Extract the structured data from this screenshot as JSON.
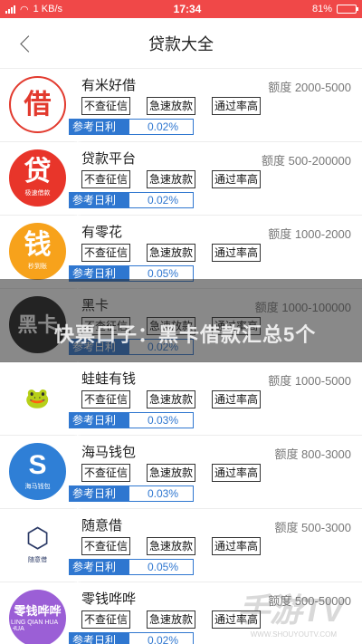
{
  "status_bar": {
    "network": "1 KB/s",
    "time": "17:34",
    "battery": "81%",
    "battery_level": 0.81
  },
  "nav": {
    "title": "贷款大全"
  },
  "rate_label": "参考日利率",
  "loans": [
    {
      "name": "有米好借",
      "quota": "额度 2000-5000",
      "tags": [
        "不查征信",
        "急速放款",
        "通过率高"
      ],
      "rate": "0.02%",
      "logo": {
        "glyph": "借",
        "sub": "",
        "bg": "#ffffff",
        "fg": "#e23a2e",
        "ring": "#e23a2e",
        "icon": "jie-logo-icon"
      }
    },
    {
      "name": "贷款平台",
      "quota": "额度 500-200000",
      "tags": [
        "不查征信",
        "急速放款",
        "通过率高"
      ],
      "rate": "0.02%",
      "logo": {
        "glyph": "贷",
        "sub": "极速借款",
        "bg": "#e8352a",
        "fg": "#ffffff",
        "ring": "#e8352a",
        "icon": "dai-logo-icon"
      }
    },
    {
      "name": "有零花",
      "quota": "额度 1000-2000",
      "tags": [
        "不查征信",
        "急速放款",
        "通过率高"
      ],
      "rate": "0.05%",
      "logo": {
        "glyph": "钱",
        "sub": "秒到账",
        "bg": "#f7a21b",
        "fg": "#ffffff",
        "ring": "#f7a21b",
        "icon": "qian-logo-icon"
      }
    },
    {
      "name": "黑卡",
      "quota": "额度 1000-100000",
      "tags": [
        "不查征信",
        "急速放款",
        "通过率高"
      ],
      "rate": "0.02%",
      "logo": {
        "glyph": "黑卡",
        "sub": "",
        "bg": "#1e1e1e",
        "fg": "#ffffff",
        "ring": "#1e1e1e",
        "icon": "black-card-logo-icon"
      }
    },
    {
      "name": "蛙蛙有钱",
      "quota": "额度 1000-5000",
      "tags": [
        "不查征信",
        "急速放款",
        "通过率高"
      ],
      "rate": "0.03%",
      "logo": {
        "glyph": "🐸",
        "sub": "",
        "bg": "#ffffff",
        "fg": "#3aa63a",
        "ring": "#ffffff",
        "icon": "frog-logo-icon"
      }
    },
    {
      "name": "海马钱包",
      "quota": "额度 800-3000",
      "tags": [
        "不查征信",
        "急速放款",
        "通过率高"
      ],
      "rate": "0.03%",
      "logo": {
        "glyph": "S",
        "sub": "海马钱包",
        "bg": "#2f7fd6",
        "fg": "#ffffff",
        "ring": "#2f7fd6",
        "icon": "seahorse-logo-icon"
      }
    },
    {
      "name": "随意借",
      "quota": "额度 500-3000",
      "tags": [
        "不查征信",
        "急速放款",
        "通过率高"
      ],
      "rate": "0.05%",
      "logo": {
        "glyph": "⬡",
        "sub": "随意借",
        "bg": "#ffffff",
        "fg": "#2b3a66",
        "ring": "#ffffff",
        "icon": "hexagon-logo-icon"
      }
    },
    {
      "name": "零钱哗哗",
      "quota": "额度 500-50000",
      "tags": [
        "不查征信",
        "急速放款",
        "通过率高"
      ],
      "rate": "0.02%",
      "logo": {
        "glyph": "零钱哗哗",
        "sub": "LING QIAN HUA HUA",
        "bg": "#9b5fd6",
        "fg": "#ffffff",
        "ring": "#9b5fd6",
        "icon": "lingqian-logo-icon"
      }
    }
  ],
  "overlay": {
    "text": "快票口子：黑卡借款汇总5个"
  },
  "watermark": {
    "text": "手游TV",
    "url": "WWW.SHOUYOUTV.COM"
  }
}
